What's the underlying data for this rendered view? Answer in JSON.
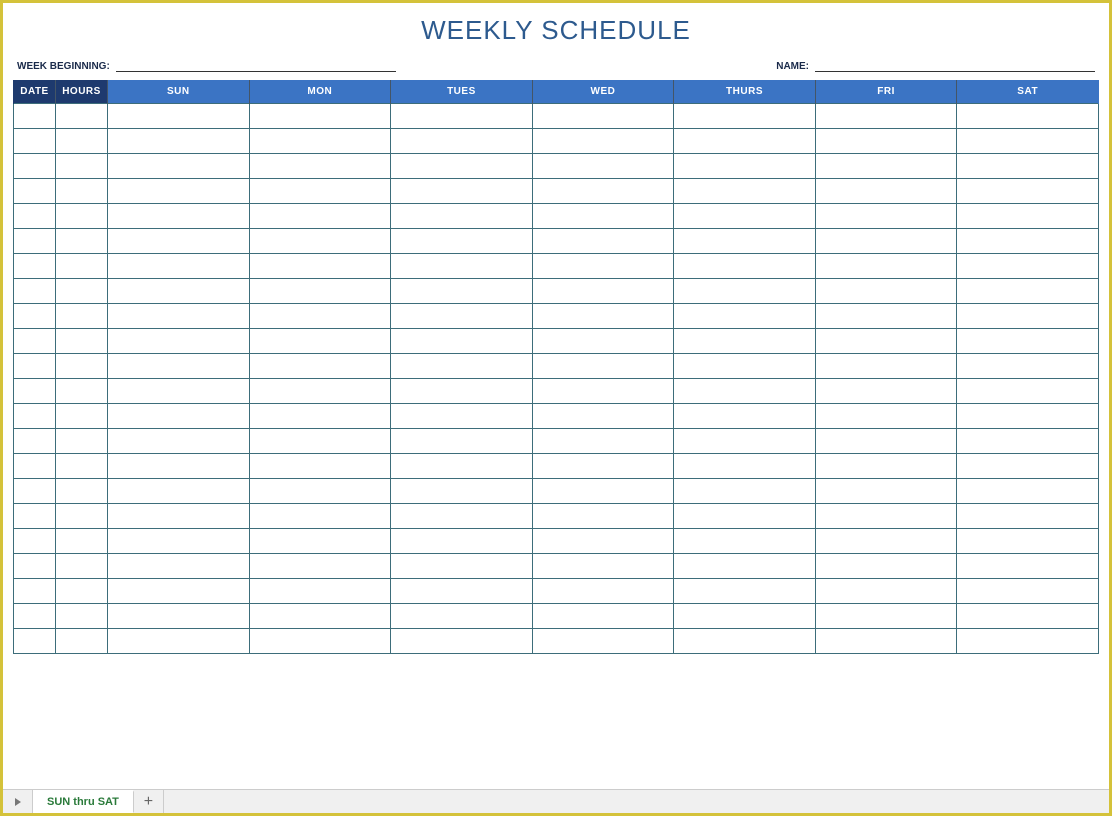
{
  "title": "WEEKLY SCHEDULE",
  "meta": {
    "week_label": "WEEK BEGINNING:",
    "week_value": "",
    "name_label": "NAME:",
    "name_value": ""
  },
  "headers": {
    "date": "DATE",
    "hours": "HOURS",
    "days": [
      "SUN",
      "MON",
      "TUES",
      "WED",
      "THURS",
      "FRI",
      "SAT"
    ]
  },
  "row_count": 22,
  "tabs": {
    "active": "SUN thru SAT"
  }
}
